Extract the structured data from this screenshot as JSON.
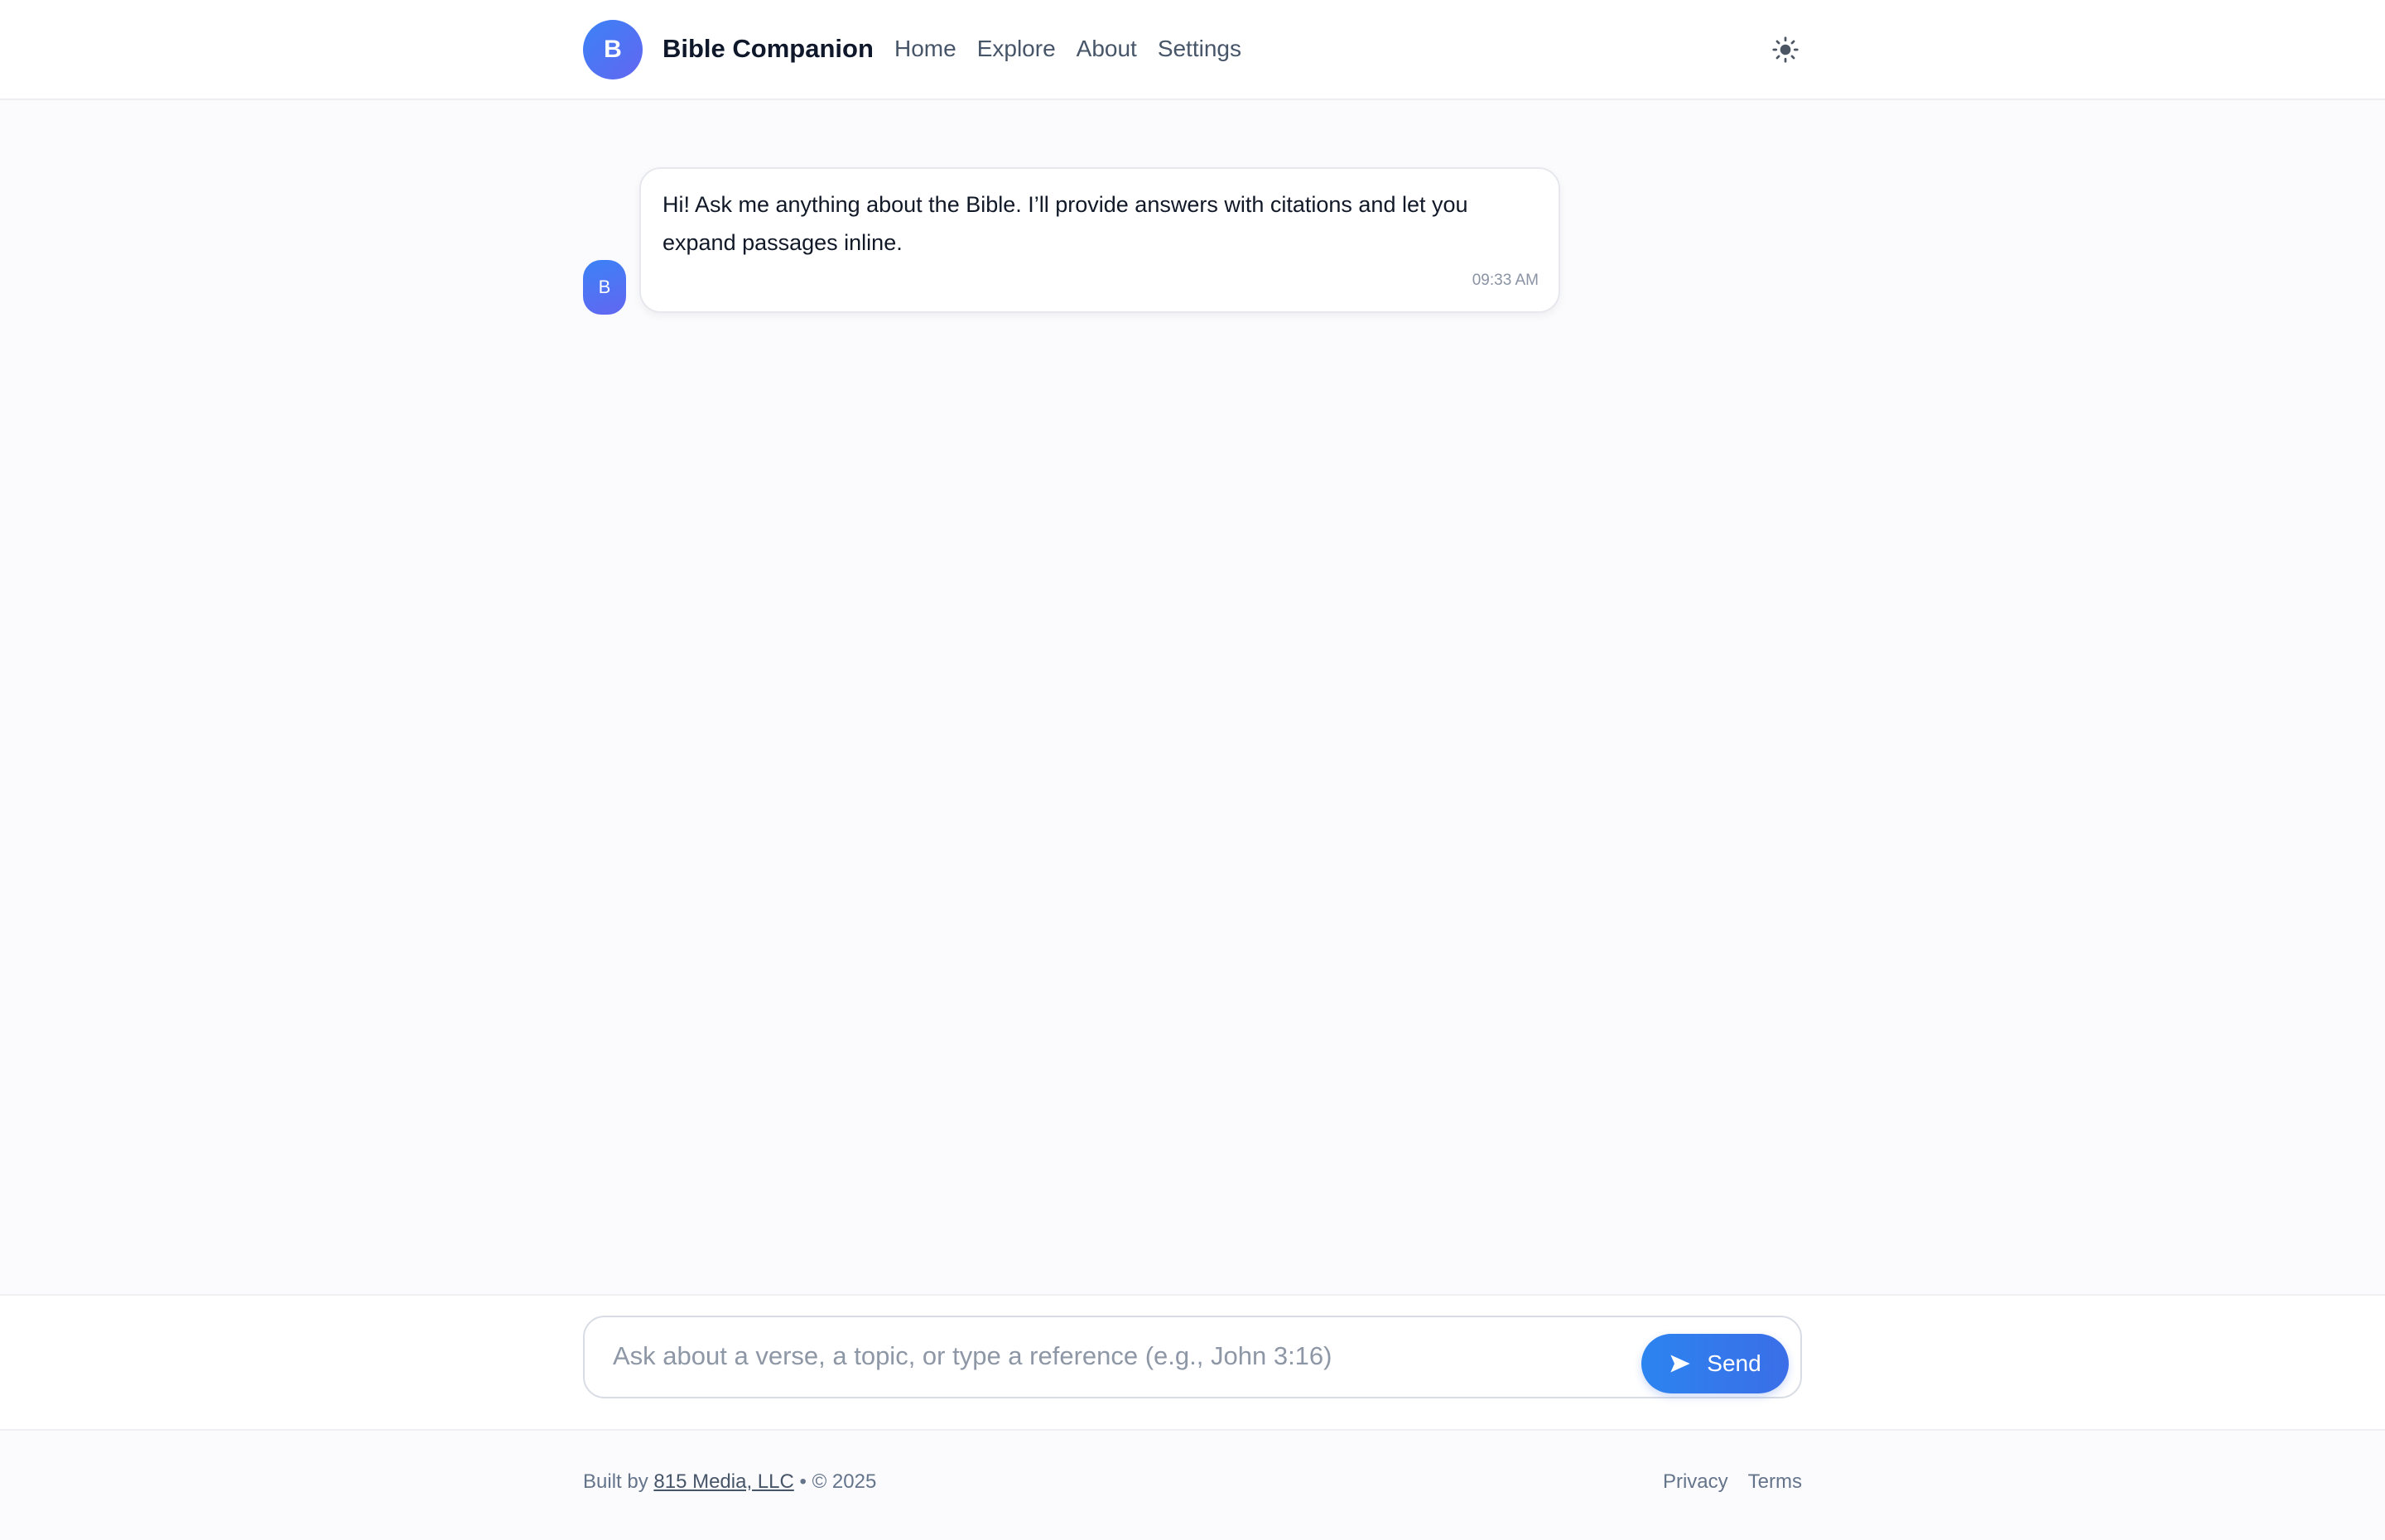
{
  "header": {
    "logo_letter": "B",
    "app_name": "Bible Companion",
    "nav": [
      "Home",
      "Explore",
      "About",
      "Settings"
    ],
    "theme_toggle_icon": "sun-icon"
  },
  "chat": {
    "messages": [
      {
        "sender": "bot",
        "avatar_letter": "B",
        "text": "Hi! Ask me anything about the Bible. I’ll provide answers with citations and let you expand passages inline.",
        "time": "09:33 AM"
      }
    ]
  },
  "composer": {
    "value": "",
    "placeholder": "Ask about a verse, a topic, or type a reference (e.g., John 3:16)",
    "send_label": "Send",
    "send_icon": "send-arrow-icon"
  },
  "footer": {
    "built_by_prefix": "Built by",
    "company": "815 Media, LLC",
    "copyright": "• © 2025",
    "links": [
      "Privacy",
      "Terms"
    ]
  },
  "colors": {
    "accent": "#3b82f6",
    "accent_secondary": "#6366f1",
    "page_background": "#fbfbfd"
  }
}
